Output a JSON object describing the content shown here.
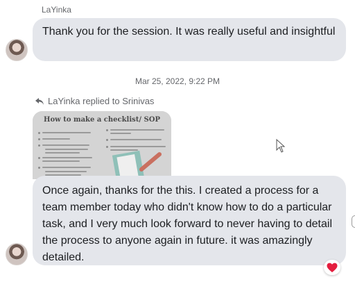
{
  "thread": {
    "sender_name": "LaYinka",
    "message_1": "Thank you for the session. It was really useful and insightful",
    "timestamp": "Mar 25, 2022, 9:22 PM",
    "reply_context": "LaYinka replied to Srinivas",
    "quoted_preview": {
      "doc_title": "How to make a checklist/ SOP"
    },
    "message_2": "Once again, thanks for the this. I created a process for a team member today who didn't know how to do a particular task, and I very much look forward to never having to detail the process to anyone again in future. it was amazingly detailed.",
    "reaction": "heart-icon"
  },
  "colors": {
    "bubble": "#e4e6eb",
    "secondary_text": "#65676b",
    "reaction_heart": "#e41e3f"
  }
}
